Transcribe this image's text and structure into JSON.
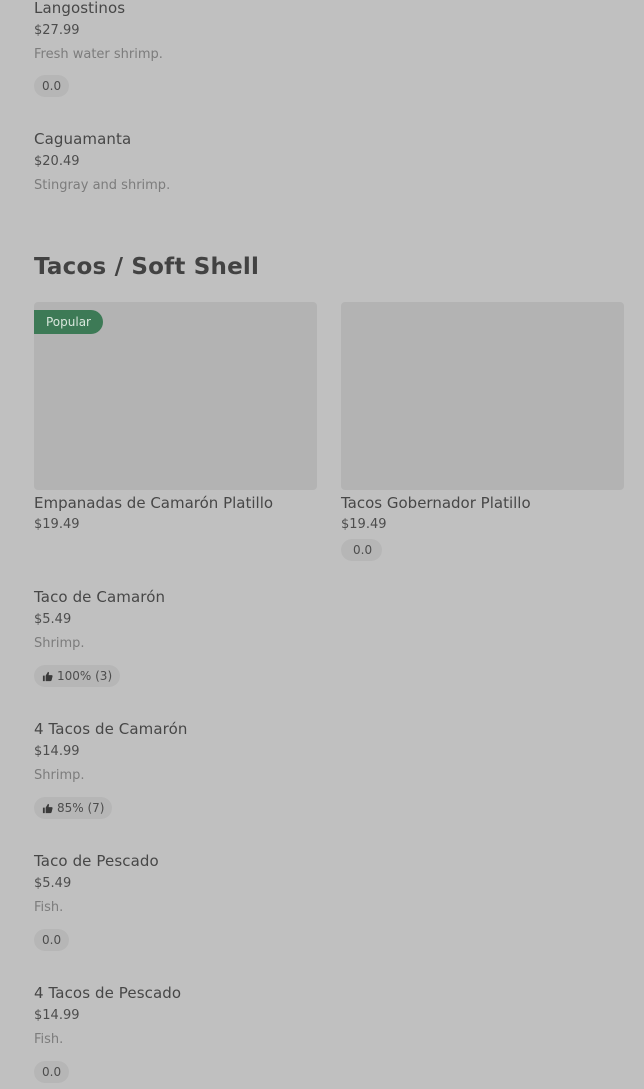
{
  "top_items": [
    {
      "name": "Langostinos",
      "price": "$27.99",
      "description": "Fresh water shrimp.",
      "rating": "0.0"
    },
    {
      "name": "Caguamanta",
      "price": "$20.49",
      "description": "Stingray and shrimp."
    }
  ],
  "section": {
    "title": "Tacos / Soft Shell",
    "cards": [
      {
        "name": "Empanadas de Camarón Platillo",
        "price": "$19.49",
        "tag": "Popular"
      },
      {
        "name": "Tacos Gobernador Platillo",
        "price": "$19.49",
        "rating": "0.0"
      }
    ],
    "items": [
      {
        "name": "Taco de Camarón",
        "price": "$5.49",
        "description": "Shrimp.",
        "rating": "100% (3)",
        "rating_icon": "thumbs-up-icon"
      },
      {
        "name": "4 Tacos de Camarón",
        "price": "$14.99",
        "description": "Shrimp.",
        "rating": "85% (7)",
        "rating_icon": "thumbs-up-icon"
      },
      {
        "name": "Taco de Pescado",
        "price": "$5.49",
        "description": "Fish.",
        "rating": "0.0"
      },
      {
        "name": "4 Tacos de Pescado",
        "price": "$14.99",
        "description": "Fish.",
        "rating": "0.0"
      }
    ]
  },
  "colors": {
    "background": "#c0c0c0",
    "popular_tag": "#3d7a56",
    "badge": "#b6b6b6"
  }
}
